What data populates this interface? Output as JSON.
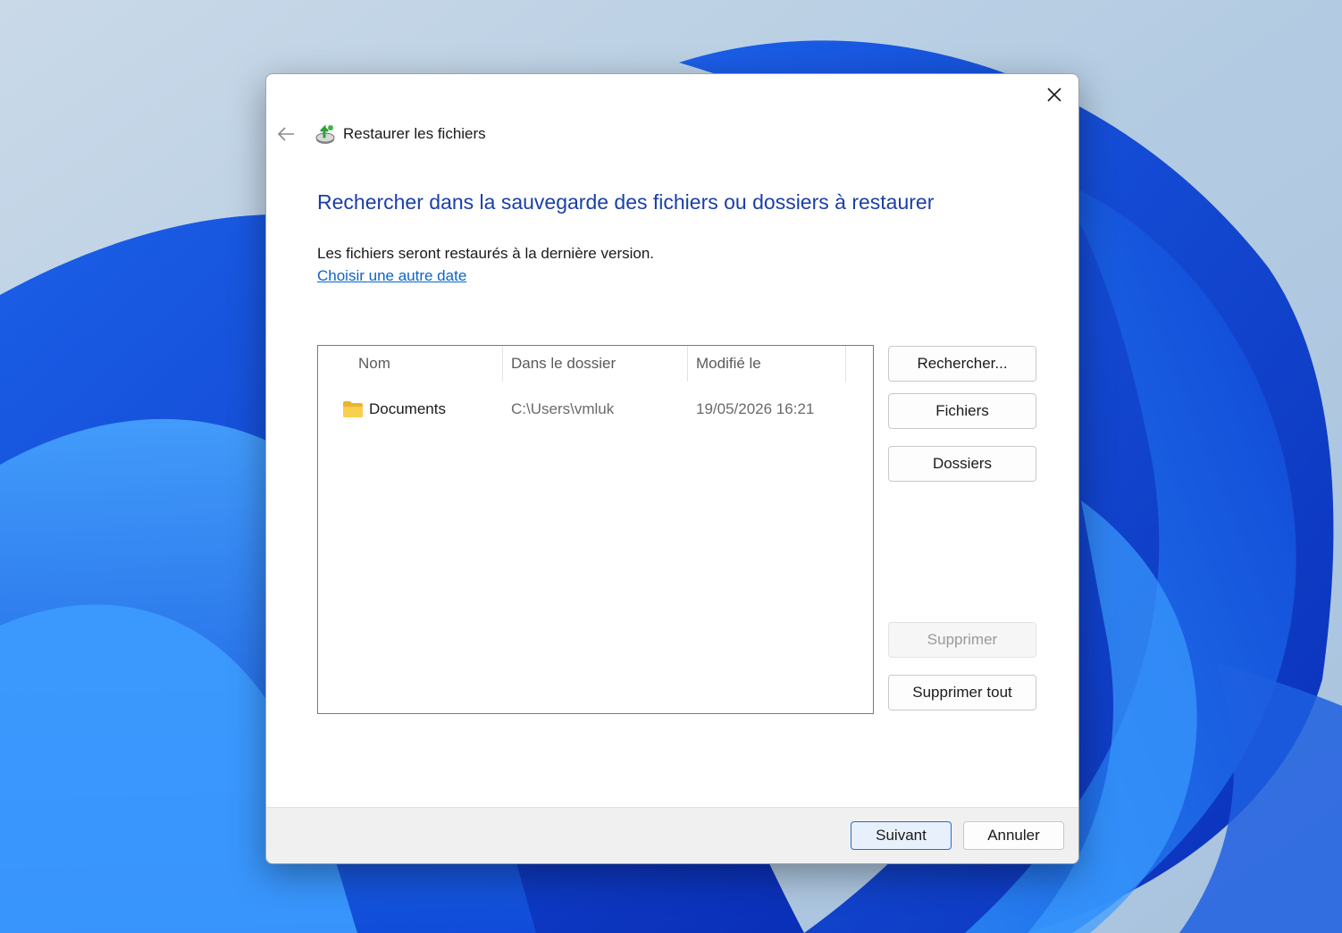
{
  "dialog": {
    "title": "Restaurer les fichiers",
    "heading": "Rechercher dans la sauvegarde des fichiers ou dossiers à restaurer",
    "info": "Les fichiers seront restaurés à la dernière version.",
    "link": "Choisir une autre date"
  },
  "list": {
    "columns": [
      "Nom",
      "Dans le dossier",
      "Modifié le"
    ],
    "rows": [
      {
        "name": "Documents",
        "folder": "C:\\Users\\vmluk",
        "modified": "19/05/2026 16:21",
        "icon": "folder-icon"
      }
    ]
  },
  "side_buttons": {
    "search": "Rechercher...",
    "files": "Fichiers",
    "folders": "Dossiers",
    "remove": "Supprimer",
    "remove_all": "Supprimer tout"
  },
  "footer": {
    "next": "Suivant",
    "cancel": "Annuler"
  },
  "colors": {
    "heading": "#1a3fa8",
    "link": "#0a64c8",
    "primary_border": "#1f6fd0"
  }
}
